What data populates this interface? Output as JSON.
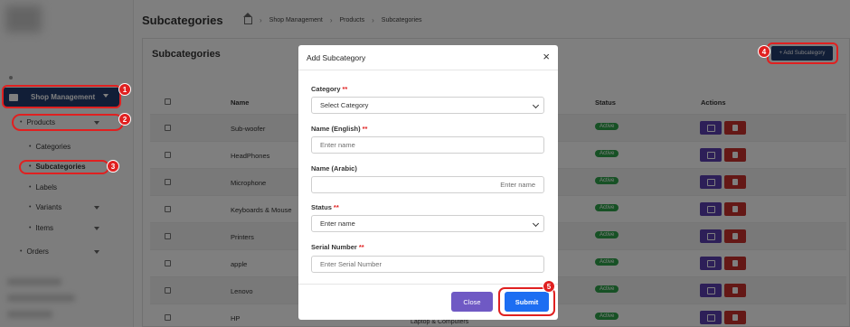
{
  "page": {
    "title": "Subcategories"
  },
  "breadcrumb": [
    "Shop Management",
    "Products",
    "Subcategories"
  ],
  "sidebar": {
    "shop_management": "Shop Management",
    "products": "Products",
    "categories": "Categories",
    "subcategories": "Subcategories",
    "labels": "Labels",
    "variants": "Variants",
    "items": "Items",
    "orders": "Orders"
  },
  "card": {
    "title": "Subcategories",
    "add_button": "+ Add Subcategory"
  },
  "table": {
    "headers": {
      "name": "Name",
      "status": "Status",
      "actions": "Actions"
    },
    "rows": [
      {
        "name": "Sub-woofer",
        "status": "Active"
      },
      {
        "name": "HeadPhones",
        "status": "Active"
      },
      {
        "name": "Microphone",
        "status": "Active"
      },
      {
        "name": "Keyboards & Mouse",
        "status": "Active"
      },
      {
        "name": "Printers",
        "status": "Active"
      },
      {
        "name": "apple",
        "status": "Active"
      },
      {
        "name": "Lenovo",
        "status": "Active"
      },
      {
        "name": "HP",
        "status": "Active"
      }
    ],
    "last_row_category": "Laptop & Computers"
  },
  "modal": {
    "title": "Add Subcategory",
    "close_symbol": "×",
    "category": {
      "label": "Category",
      "required": "**",
      "value": "Select Category"
    },
    "name_en": {
      "label": "Name (English)",
      "required": "**",
      "placeholder": "Enter name"
    },
    "name_ar": {
      "label": "Name (Arabic)",
      "placeholder": "Enter name"
    },
    "status": {
      "label": "Status",
      "required": "**",
      "value": "Enter name"
    },
    "serial": {
      "label": "Serial Number",
      "required": "**",
      "placeholder": "Enter Serial Number"
    },
    "close_button": "Close",
    "submit_button": "Submit"
  },
  "annotations": [
    "1",
    "2",
    "3",
    "4",
    "5"
  ],
  "colors": {
    "brand": "#233c6e",
    "active_badge": "#2fa34a",
    "edit_button": "#5a3fb0",
    "delete_button": "#c9302c",
    "submit_button": "#1d6ef2",
    "close_button": "#6f59c4",
    "annotation": "#e02020"
  }
}
